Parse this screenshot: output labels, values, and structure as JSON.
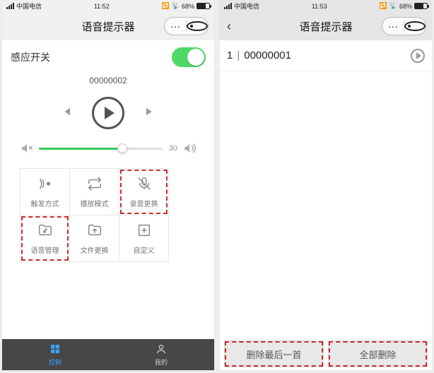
{
  "left": {
    "status": {
      "carrier": "中国电信",
      "time": "11:52",
      "battery": "68%"
    },
    "header": {
      "title": "语音提示器",
      "more": "···"
    },
    "switch_label": "感应开关",
    "switch_on": true,
    "track": "00000002",
    "volume": {
      "value": 30,
      "percent": 68
    },
    "grid": [
      {
        "label": "触发方式",
        "icon": "antenna"
      },
      {
        "label": "播放模式",
        "icon": "repeat"
      },
      {
        "label": "录音更换",
        "icon": "mic-off",
        "highlight": true
      },
      {
        "label": "语音管理",
        "icon": "folder-music",
        "highlight": true
      },
      {
        "label": "文件更换",
        "icon": "folder-up"
      },
      {
        "label": "自定义",
        "icon": "plus"
      }
    ],
    "tabs": [
      {
        "label": "控制",
        "icon": "grid",
        "active": true
      },
      {
        "label": "我的",
        "icon": "user",
        "active": false
      }
    ]
  },
  "right": {
    "status": {
      "carrier": "中国电信",
      "time": "11:53",
      "battery": "68%"
    },
    "header": {
      "title": "语音提示器",
      "more": "···"
    },
    "files": [
      {
        "index": "1",
        "name": "00000001"
      }
    ],
    "buttons": {
      "delete_last": "删除最后一首",
      "delete_all": "全部删除"
    }
  }
}
